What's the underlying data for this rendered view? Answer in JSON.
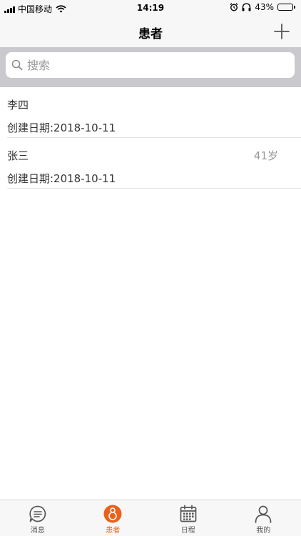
{
  "status_bar": {
    "carrier": "中国移动",
    "time": "14:19",
    "battery": "43%",
    "battery_level": 0.43,
    "icons": [
      "signal-icon",
      "wifi-icon",
      "alarm-icon",
      "headphones-icon",
      "battery-icon"
    ]
  },
  "nav": {
    "title": "患者",
    "add_icon": "plus-icon"
  },
  "search": {
    "placeholder": "搜索",
    "value": "",
    "icon": "search-icon"
  },
  "patients": [
    {
      "name": "李四",
      "age": "",
      "date": "创建日期:2018-10-11"
    },
    {
      "name": "张三",
      "age": "41岁",
      "date": "创建日期:2018-10-11"
    }
  ],
  "tabs": [
    {
      "label": "消息",
      "icon": "message-icon",
      "active": false
    },
    {
      "label": "患者",
      "icon": "patient-icon",
      "active": true
    },
    {
      "label": "日程",
      "icon": "calendar-icon",
      "active": false
    },
    {
      "label": "我的",
      "icon": "user-icon",
      "active": false
    }
  ],
  "colors": {
    "accent": "#e8621a",
    "nav_background": "#f7f7f7",
    "search_background": "#c9c9ce",
    "inactive_icon": "#555555"
  }
}
